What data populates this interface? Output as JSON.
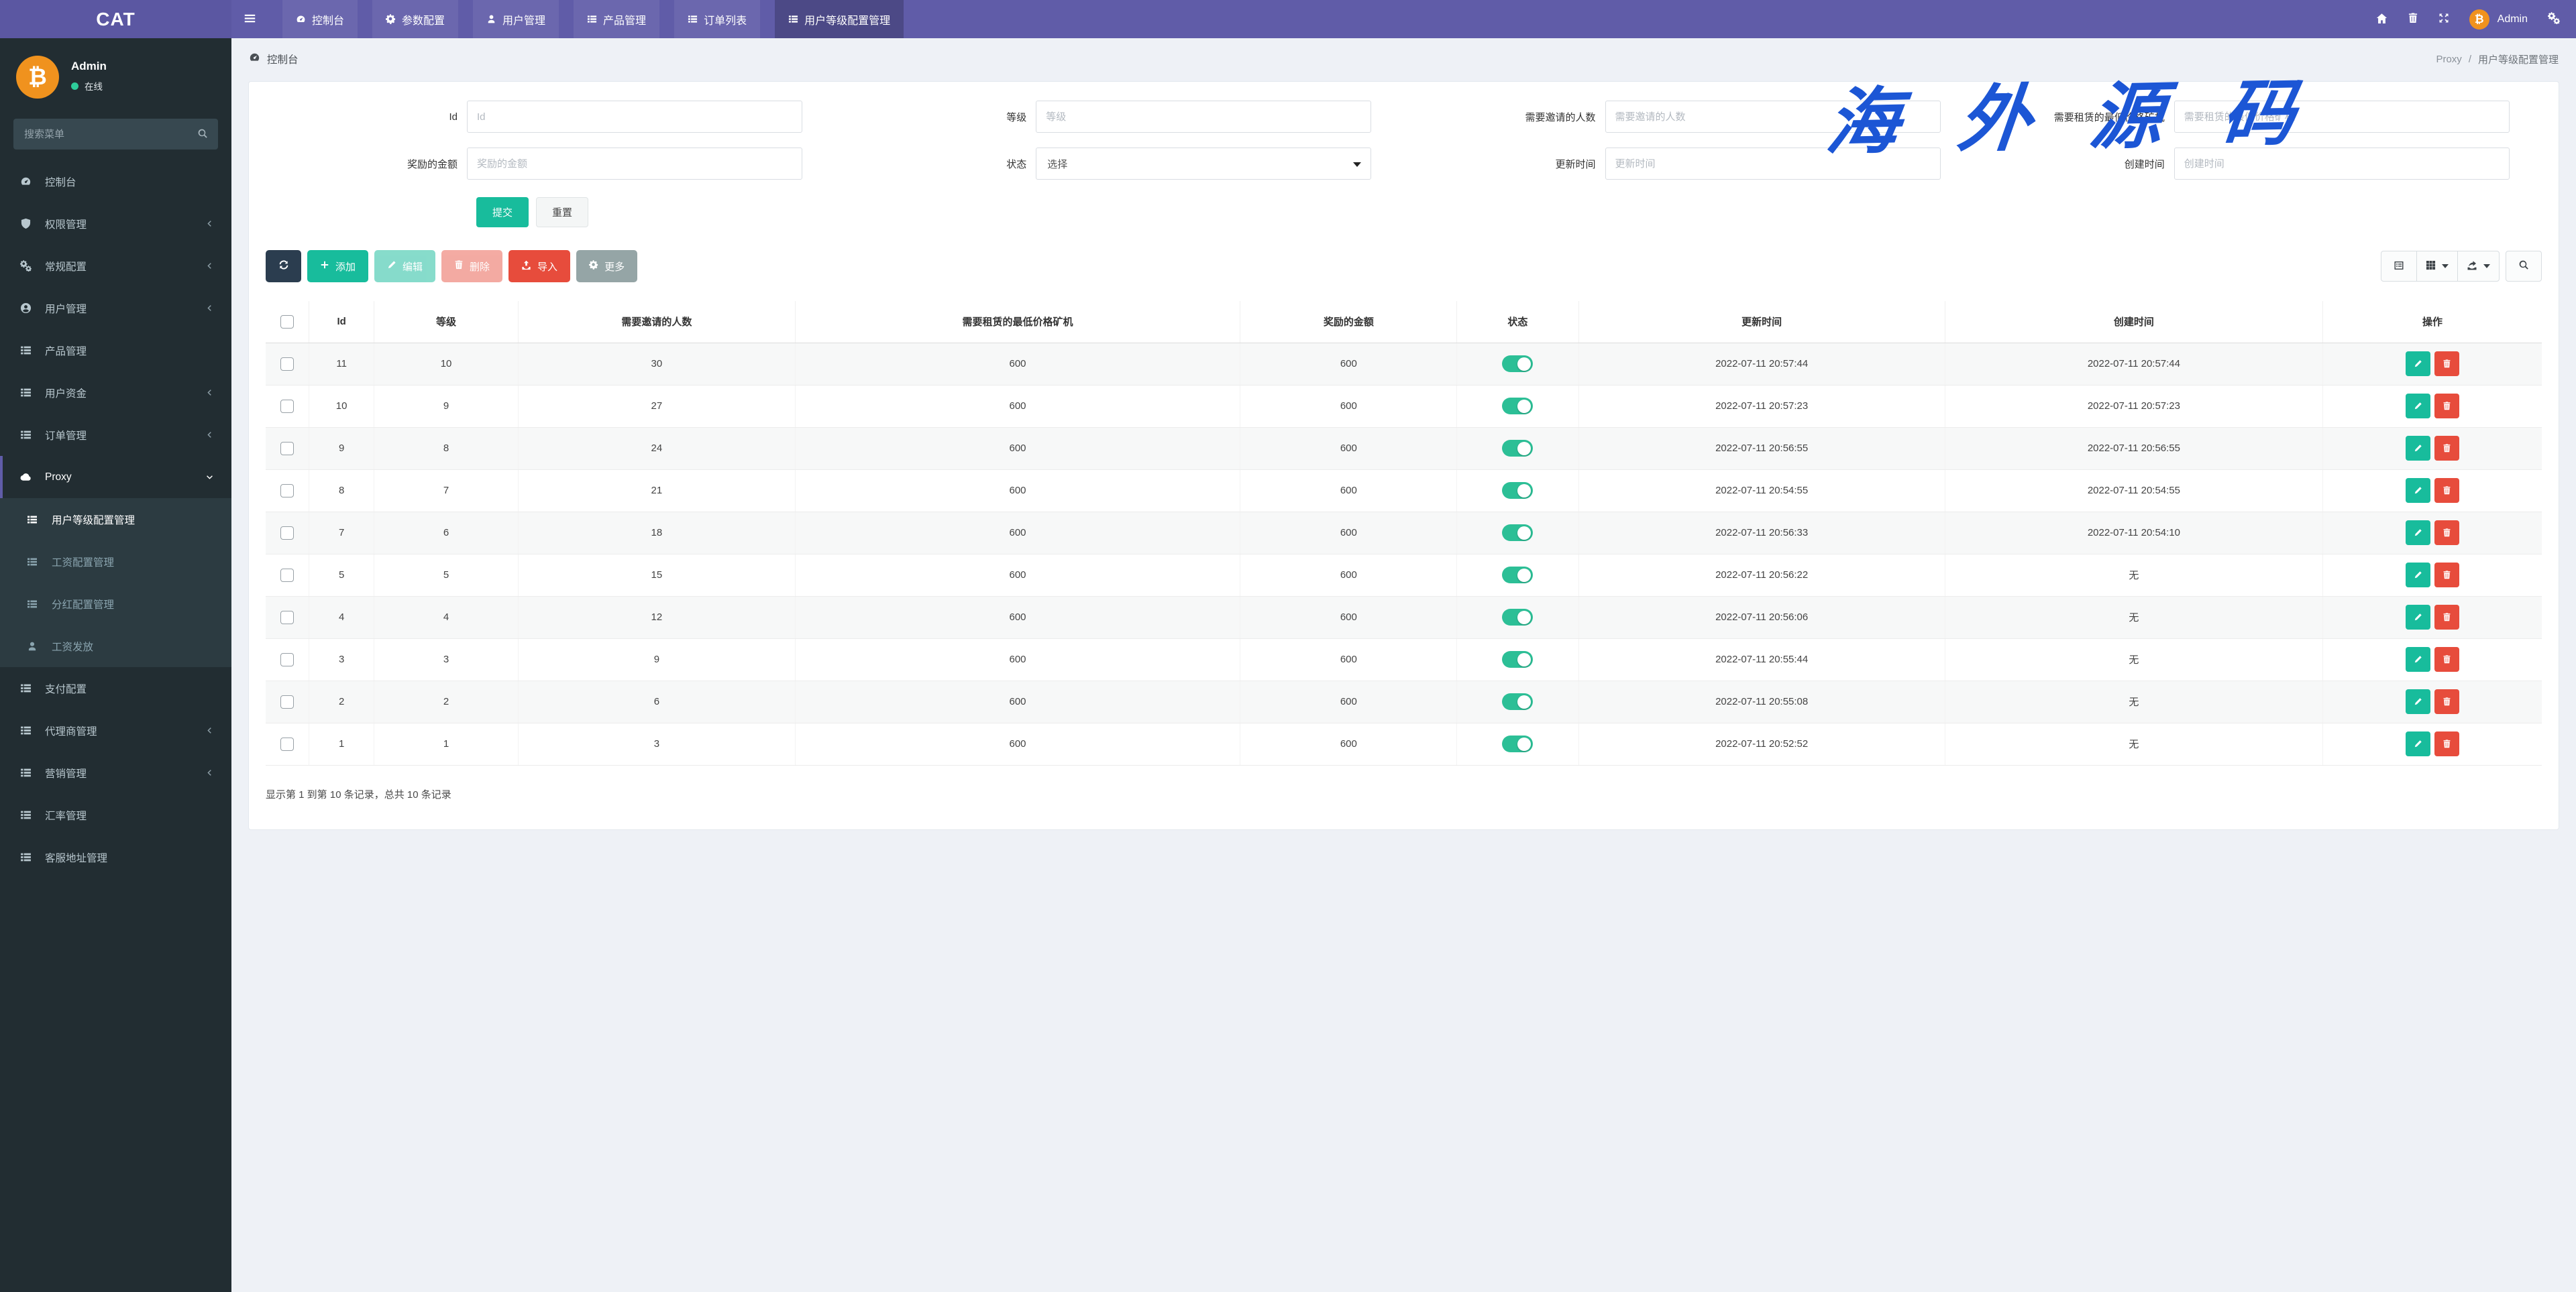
{
  "navbar": {
    "brand": "CAT",
    "items": [
      {
        "label": "控制台",
        "icon": "gauge",
        "active": false
      },
      {
        "label": "参数配置",
        "icon": "gear",
        "active": false
      },
      {
        "label": "用户管理",
        "icon": "user",
        "active": false
      },
      {
        "label": "产品管理",
        "icon": "th-list",
        "active": false
      },
      {
        "label": "订单列表",
        "icon": "th-list",
        "active": false
      },
      {
        "label": "用户等级配置管理",
        "icon": "th-list",
        "active": true
      }
    ],
    "user_label": "Admin"
  },
  "sidebar": {
    "user": {
      "name": "Admin",
      "status": "在线"
    },
    "search_placeholder": "搜索菜单",
    "items": [
      {
        "label": "控制台",
        "icon": "gauge",
        "chevron": null,
        "active": false
      },
      {
        "label": "权限管理",
        "icon": "shield",
        "chevron": "left",
        "active": false
      },
      {
        "label": "常规配置",
        "icon": "gears",
        "chevron": "left",
        "active": false
      },
      {
        "label": "用户管理",
        "icon": "user-circle",
        "chevron": "left",
        "active": false
      },
      {
        "label": "产品管理",
        "icon": "th-list",
        "chevron": null,
        "active": false
      },
      {
        "label": "用户资金",
        "icon": "th-list",
        "chevron": "left",
        "active": false
      },
      {
        "label": "订单管理",
        "icon": "th-list",
        "chevron": "left",
        "active": false
      },
      {
        "label": "Proxy",
        "icon": "cloud",
        "chevron": "down",
        "active": true,
        "children": [
          {
            "label": "用户等级配置管理",
            "icon": "th-list",
            "active": true
          },
          {
            "label": "工资配置管理",
            "icon": "th-list",
            "active": false
          },
          {
            "label": "分红配置管理",
            "icon": "th-list",
            "active": false
          },
          {
            "label": "工资发放",
            "icon": "person",
            "active": false
          }
        ]
      },
      {
        "label": "支付配置",
        "icon": "th-list",
        "chevron": null,
        "active": false
      },
      {
        "label": "代理商管理",
        "icon": "th-list",
        "chevron": "left",
        "active": false
      },
      {
        "label": "营销管理",
        "icon": "th-list",
        "chevron": "left",
        "active": false
      },
      {
        "label": "汇率管理",
        "icon": "th-list",
        "chevron": null,
        "active": false
      },
      {
        "label": "客服地址管理",
        "icon": "th-list",
        "chevron": null,
        "active": false
      }
    ]
  },
  "breadcrumb": {
    "title": "控制台",
    "parent": "Proxy",
    "separator": "/",
    "current": "用户等级配置管理"
  },
  "filters": {
    "fields": [
      {
        "label": "Id",
        "placeholder": "Id",
        "type": "text"
      },
      {
        "label": "等级",
        "placeholder": "等级",
        "type": "text"
      },
      {
        "label": "需要邀请的人数",
        "placeholder": "需要邀请的人数",
        "type": "text"
      },
      {
        "label": "需要租赁的最低价格矿机",
        "placeholder": "需要租赁的最低价格矿机",
        "type": "text"
      },
      {
        "label": "奖励的金额",
        "placeholder": "奖励的金额",
        "type": "text"
      },
      {
        "label": "状态",
        "value": "选择",
        "type": "select"
      },
      {
        "label": "更新时间",
        "placeholder": "更新时间",
        "type": "text"
      },
      {
        "label": "创建时间",
        "placeholder": "创建时间",
        "type": "text"
      }
    ],
    "submit_label": "提交",
    "reset_label": "重置"
  },
  "toolbar": {
    "add_label": "添加",
    "edit_label": "编辑",
    "delete_label": "删除",
    "import_label": "导入",
    "more_label": "更多"
  },
  "table": {
    "columns": [
      "Id",
      "等级",
      "需要邀请的人数",
      "需要租赁的最低价格矿机",
      "奖励的金额",
      "状态",
      "更新时间",
      "创建时间",
      "操作"
    ],
    "rows": [
      {
        "id": "11",
        "level": "10",
        "invite_count": "30",
        "min_miner_price": "600",
        "reward_amount": "600",
        "status_on": true,
        "updated_at": "2022-07-11 20:57:44",
        "created_at": "2022-07-11 20:57:44"
      },
      {
        "id": "10",
        "level": "9",
        "invite_count": "27",
        "min_miner_price": "600",
        "reward_amount": "600",
        "status_on": true,
        "updated_at": "2022-07-11 20:57:23",
        "created_at": "2022-07-11 20:57:23"
      },
      {
        "id": "9",
        "level": "8",
        "invite_count": "24",
        "min_miner_price": "600",
        "reward_amount": "600",
        "status_on": true,
        "updated_at": "2022-07-11 20:56:55",
        "created_at": "2022-07-11 20:56:55"
      },
      {
        "id": "8",
        "level": "7",
        "invite_count": "21",
        "min_miner_price": "600",
        "reward_amount": "600",
        "status_on": true,
        "updated_at": "2022-07-11 20:54:55",
        "created_at": "2022-07-11 20:54:55"
      },
      {
        "id": "7",
        "level": "6",
        "invite_count": "18",
        "min_miner_price": "600",
        "reward_amount": "600",
        "status_on": true,
        "updated_at": "2022-07-11 20:56:33",
        "created_at": "2022-07-11 20:54:10"
      },
      {
        "id": "5",
        "level": "5",
        "invite_count": "15",
        "min_miner_price": "600",
        "reward_amount": "600",
        "status_on": true,
        "updated_at": "2022-07-11 20:56:22",
        "created_at": "无"
      },
      {
        "id": "4",
        "level": "4",
        "invite_count": "12",
        "min_miner_price": "600",
        "reward_amount": "600",
        "status_on": true,
        "updated_at": "2022-07-11 20:56:06",
        "created_at": "无"
      },
      {
        "id": "3",
        "level": "3",
        "invite_count": "9",
        "min_miner_price": "600",
        "reward_amount": "600",
        "status_on": true,
        "updated_at": "2022-07-11 20:55:44",
        "created_at": "无"
      },
      {
        "id": "2",
        "level": "2",
        "invite_count": "6",
        "min_miner_price": "600",
        "reward_amount": "600",
        "status_on": true,
        "updated_at": "2022-07-11 20:55:08",
        "created_at": "无"
      },
      {
        "id": "1",
        "level": "1",
        "invite_count": "3",
        "min_miner_price": "600",
        "reward_amount": "600",
        "status_on": true,
        "updated_at": "2022-07-11 20:52:52",
        "created_at": "无"
      }
    ],
    "summary": "显示第 1 到第 10 条记录，总共 10 条记录"
  },
  "watermark": "海外源码",
  "colors": {
    "navbar_purple": "#605ca8",
    "sidebar_dark": "#222d32",
    "submenu_dark": "#2c3b41",
    "accent_green": "#18bc9c",
    "accent_red": "#e74c3c",
    "toggle_green": "#2cbf96",
    "refresh_dark": "#2b3d4f",
    "more_gray": "#95a5a6",
    "avatar_orange": "#f0921e",
    "watermark_blue": "#1c56d5"
  }
}
